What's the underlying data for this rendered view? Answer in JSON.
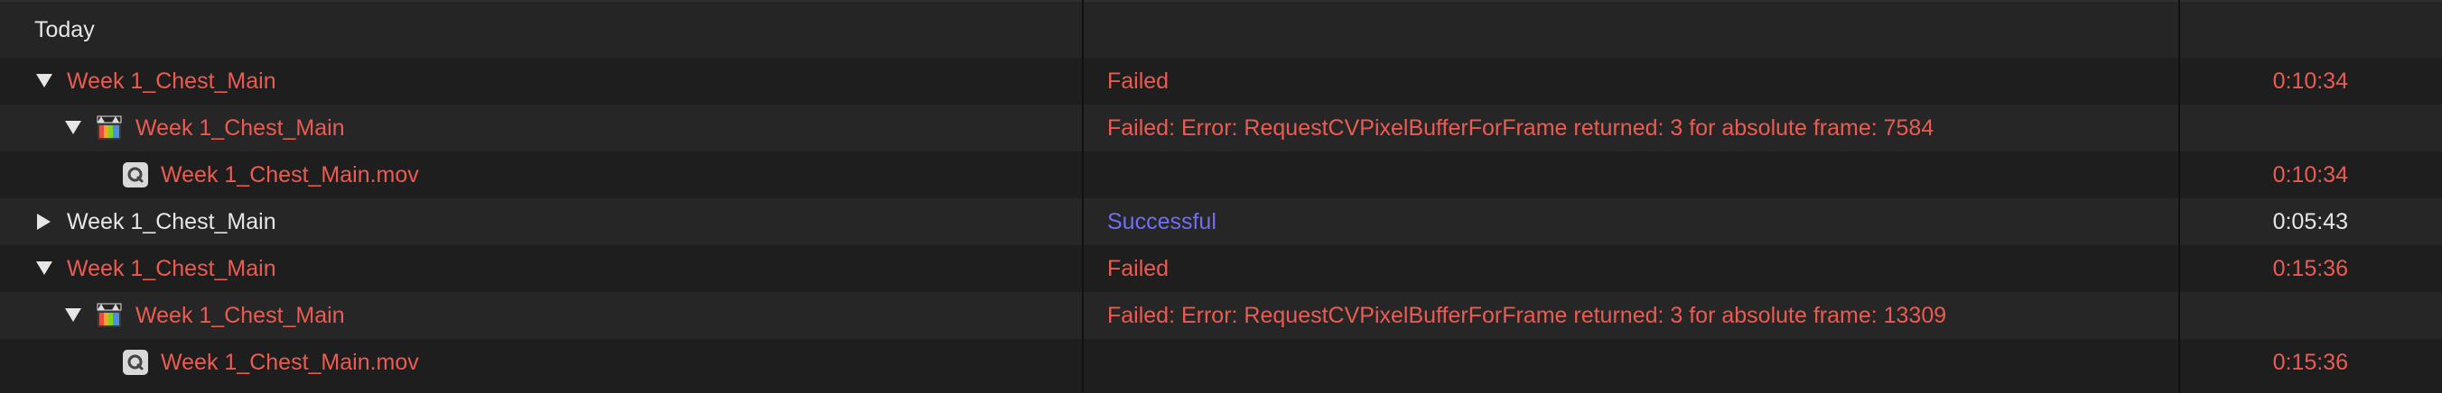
{
  "section": {
    "title": "Today"
  },
  "rows": [
    {
      "name": "Week 1_Chest_Main",
      "status": "Failed",
      "duration": "0:10:34"
    },
    {
      "name": "Week 1_Chest_Main",
      "status": "Failed: Error: RequestCVPixelBufferForFrame returned: 3 for absolute frame: 7584",
      "duration": ""
    },
    {
      "name": "Week 1_Chest_Main.mov",
      "status": "",
      "duration": "0:10:34"
    },
    {
      "name": "Week 1_Chest_Main",
      "status": "Successful",
      "duration": "0:05:43"
    },
    {
      "name": "Week 1_Chest_Main",
      "status": "Failed",
      "duration": "0:15:36"
    },
    {
      "name": "Week 1_Chest_Main",
      "status": "Failed: Error: RequestCVPixelBufferForFrame returned: 3 for absolute frame: 13309",
      "duration": ""
    },
    {
      "name": "Week 1_Chest_Main.mov",
      "status": "",
      "duration": "0:15:36"
    }
  ],
  "colors": {
    "failed": "#ec5b52",
    "success": "#6f6ff2",
    "normal": "#e6e6e6"
  }
}
